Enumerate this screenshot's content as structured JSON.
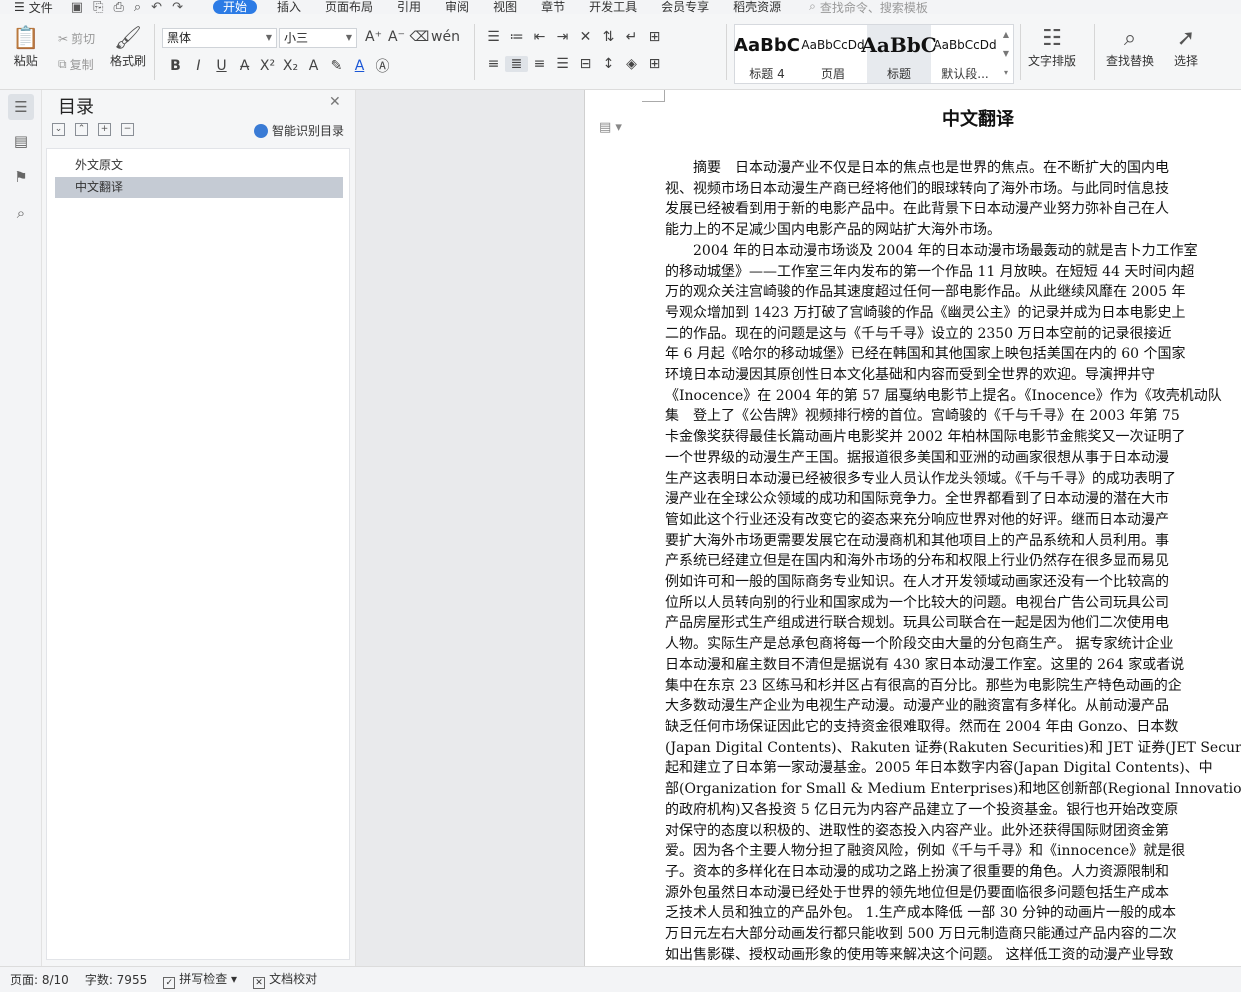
{
  "menubar": {
    "file_label": "文件",
    "tabs": [
      {
        "label": "开始",
        "active": true
      },
      {
        "label": "插入"
      },
      {
        "label": "页面布局"
      },
      {
        "label": "引用"
      },
      {
        "label": "审阅"
      },
      {
        "label": "视图"
      },
      {
        "label": "章节"
      },
      {
        "label": "开发工具"
      },
      {
        "label": "会员专享"
      },
      {
        "label": "稻壳资源"
      }
    ],
    "search_placeholder": "查找命令、搜索模板"
  },
  "ribbon": {
    "paste_label": "粘贴",
    "cut_label": "剪切",
    "copy_label": "复制",
    "format_painter_label": "格式刷",
    "font_name": "黑体",
    "font_size": "小三",
    "styles": [
      {
        "sample": "AaBbC",
        "label": "标题 4"
      },
      {
        "sample": "AaBbCcDd",
        "label": "页眉"
      },
      {
        "sample": "AaBbC",
        "label": "标题",
        "selected": true
      },
      {
        "sample": "AaBbCcDd",
        "label": "默认段..."
      }
    ],
    "text_layout_label": "文字排版",
    "find_replace_label": "查找替换",
    "select_label": "选择"
  },
  "toc": {
    "title": "目录",
    "smart_label": "智能识别目录",
    "items": [
      {
        "label": "外文原文",
        "selected": false
      },
      {
        "label": "中文翻译",
        "selected": true
      }
    ]
  },
  "document": {
    "title": "中文翻译",
    "lines": [
      "　　摘要　日本动漫产业不仅是日本的焦点也是世界的焦点。在不断扩大的国内电",
      "视、视频市场日本动漫生产商已经将他们的眼球转向了海外市场。与此同时信息技",
      "发展已经被看到用于新的电影产品中。在此背景下日本动漫产业努力弥补自己在人",
      "能力上的不足减少国内电影产品的网站扩大海外市场。",
      "　　2004 年的日本动漫市场谈及 2004 年的日本动漫市场最轰动的就是吉卜力工作室",
      "的移动城堡》——工作室三年内发布的第一个作品 11 月放映。在短短 44 天时间内超",
      "万的观众关注宫崎骏的作品其速度超过任何一部电影作品。从此继续风靡在 2005 年",
      "号观众增加到 1423 万打破了宫崎骏的作品《幽灵公主》的记录并成为日本电影史上",
      "二的作品。现在的问题是这与《千与千寻》设立的 2350 万日本空前的记录很接近",
      "年 6 月起《哈尔的移动城堡》已经在韩国和其他国家上映包括美国在内的 60 个国家",
      "环境日本动漫因其原创性日本文化基础和内容而受到全世界的欢迎。导演押井守",
      "《Inocence》在 2004 年的第 57 届戛纳电影节上提名。《Inocence》作为《攻壳机动队",
      "集　登上了《公告牌》视频排行榜的首位。宫崎骏的《千与千寻》在 2003 年第 75",
      "卡金像奖获得最佳长篇动画片电影奖并 2002 年柏林国际电影节金熊奖又一次证明了",
      "一个世界级的动漫生产王国。据报道很多美国和亚洲的动画家很想从事于日本动漫",
      "生产这表明日本动漫已经被很多专业人员认作龙头领域。《千与千寻》的成功表明了",
      "漫产业在全球公众领域的成功和国际竞争力。全世界都看到了日本动漫的潜在大市",
      "管如此这个行业还没有改变它的姿态来充分响应世界对他的好评。继而日本动漫产",
      "要扩大海外市场更需要发展它在动漫商机和其他项目上的产品系统和人员利用。事",
      "产系统已经建立但是在国内和海外市场的分布和权限上行业仍然存在很多显而易见",
      "例如许可和一般的国际商务专业知识。在人才开发领域动画家还没有一个比较高的",
      "位所以人员转向别的行业和国家成为一个比较大的问题。电视台广告公司玩具公司",
      "产品房屋形式生产组成进行联合规划。玩具公司联合在一起是因为他们二次使用电",
      "人物。实际生产是总承包商将每一个阶段交由大量的分包商生产。 据专家统计企业",
      "日本动漫和雇主数目不清但是据说有 430 家日本动漫工作室。这里的 264 家或者说",
      "集中在东京 23 区练马和杉并区占有很高的百分比。那些为电影院生产特色动画的企",
      "大多数动漫生产企业为电视生产动漫。动漫产业的融资富有多样化。从前动漫产品",
      "缺乏任何市场保证因此它的支持资金很难取得。然而在 2004 年由 Gonzo、日本数",
      "(Japan Digital Contents)、Rakuten 证券(Rakuten Securities)和 JET 证券(JET Securities",
      "起和建立了日本第一家动漫基金。2005 年日本数字内容(Japan Digital Contents)、中",
      "部(Organization for Small & Medium Enterprises)和地区创新部(Regional Innovation 一",
      "的政府机构)又各投资 5 亿日元为内容产品建立了一个投资基金。银行也开始改变原",
      "对保守的态度以积极的、进取性的姿态投入内容产业。此外还获得国际财团资金第",
      "爱。因为各个主要人物分担了融资风险，例如《千与千寻》和《innocence》就是很",
      "子。资本的多样化在日本动漫的成功之路上扮演了很重要的角色。人力资源限制和",
      "源外包虽然日本动漫已经处于世界的领先地位但是仍要面临很多问题包括生产成本",
      "乏技术人员和独立的产品外包。 1.生产成本降低 一部 30 分钟的动画片一般的成本",
      "万日元左右大部分动画发行都只能收到 500 万日元制造商只能通过产品内容的二次",
      "如出售影碟、授权动画形象的使用等来解决这个问题。 这样低工资的动漫产业导致"
    ]
  },
  "statusbar": {
    "page": "页面: 8/10",
    "words": "字数: 7955",
    "spellcheck": "拼写检查",
    "doc_check": "文档校对"
  }
}
